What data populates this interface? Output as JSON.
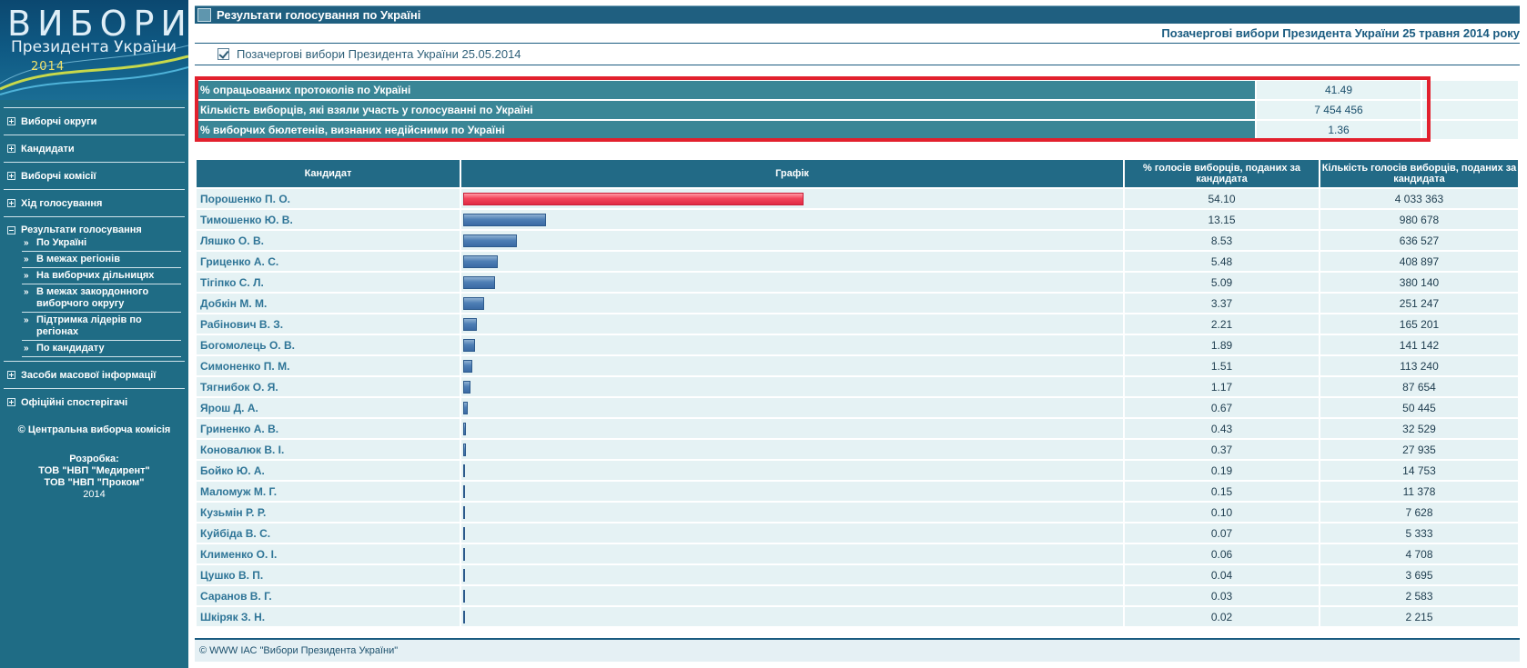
{
  "logo": {
    "big": "ВИБОРИ",
    "sub": "Президента України",
    "year": "2014"
  },
  "nav": {
    "items_top": [
      {
        "label": "Виборчі округи"
      },
      {
        "label": "Кандидати"
      },
      {
        "label": "Виборчі комісії"
      },
      {
        "label": "Хід голосування"
      }
    ],
    "open_item": "Результати голосування",
    "sub_items": [
      {
        "label": "По Україні"
      },
      {
        "label": "В межах регіонів"
      },
      {
        "label": "На виборчих дільницях"
      },
      {
        "label": "В межах закордонного виборчого округу"
      },
      {
        "label": "Підтримка лідерів по регіонах"
      },
      {
        "label": "По кандидату"
      }
    ],
    "items_bottom": [
      {
        "label": "Засоби масової інформації"
      },
      {
        "label": "Офіційні спостерігачі"
      }
    ],
    "copyright": "© Центральна виборча комісія",
    "dev_label": "Розробка:",
    "dev_line1": "ТОВ \"НВП \"Медирент\"",
    "dev_line2": "ТОВ \"НВП \"Проком\"",
    "dev_year": "2014"
  },
  "header": {
    "title": "Результати голосування по Україні",
    "election_title": "Позачергові вибори Президента України 25 травня 2014 року",
    "election_checkbox_label": "Позачергові вибори Президента України 25.05.2014"
  },
  "summary": [
    {
      "label": "% опрацьованих протоколів по Україні",
      "value": "41.49"
    },
    {
      "label": "Кількість виборців, які взяли участь у голосуванні по Україні",
      "value": "7 454 456"
    },
    {
      "label": "% виборчих бюлетенів, визнаних недійсними по Україні",
      "value": "1.36"
    }
  ],
  "results": {
    "headers": {
      "candidate": "Кандидат",
      "graph": "Графік",
      "pct": "% голосів виборців, поданих за кандидата",
      "count": "Кількість голосів виборців, поданих за кандидата"
    },
    "rows": [
      {
        "name": "Порошенко П. О.",
        "pct": "54.10",
        "count": "4 033 363"
      },
      {
        "name": "Тимошенко Ю. В.",
        "pct": "13.15",
        "count": "980 678"
      },
      {
        "name": "Ляшко О. В.",
        "pct": "8.53",
        "count": "636 527"
      },
      {
        "name": "Гриценко А. С.",
        "pct": "5.48",
        "count": "408 897"
      },
      {
        "name": "Тігіпко С. Л.",
        "pct": "5.09",
        "count": "380 140"
      },
      {
        "name": "Добкін М. М.",
        "pct": "3.37",
        "count": "251 247"
      },
      {
        "name": "Рабінович В. З.",
        "pct": "2.21",
        "count": "165 201"
      },
      {
        "name": "Богомолець О. В.",
        "pct": "1.89",
        "count": "141 142"
      },
      {
        "name": "Симоненко П. М.",
        "pct": "1.51",
        "count": "113 240"
      },
      {
        "name": "Тягнибок О. Я.",
        "pct": "1.17",
        "count": "87 654"
      },
      {
        "name": "Ярош Д. А.",
        "pct": "0.67",
        "count": "50 445"
      },
      {
        "name": "Гриненко А. В.",
        "pct": "0.43",
        "count": "32 529"
      },
      {
        "name": "Коновалюк В. І.",
        "pct": "0.37",
        "count": "27 935"
      },
      {
        "name": "Бойко Ю. А.",
        "pct": "0.19",
        "count": "14 753"
      },
      {
        "name": "Маломуж М. Г.",
        "pct": "0.15",
        "count": "11 378"
      },
      {
        "name": "Кузьмін Р. Р.",
        "pct": "0.10",
        "count": "7 628"
      },
      {
        "name": "Куйбіда В. С.",
        "pct": "0.07",
        "count": "5 333"
      },
      {
        "name": "Клименко О. І.",
        "pct": "0.06",
        "count": "4 708"
      },
      {
        "name": "Цушко В. П.",
        "pct": "0.04",
        "count": "3 695"
      },
      {
        "name": "Саранов В. Г.",
        "pct": "0.03",
        "count": "2 583"
      },
      {
        "name": "Шкіряк З. Н.",
        "pct": "0.02",
        "count": "2 215"
      }
    ]
  },
  "footer": {
    "text": "© WWW ІАС \"Вибори Президента України\""
  },
  "colors": {
    "sidebar": "#1f6c85",
    "header_bar": "#1f5f80",
    "summary_label_bg": "#3a8696",
    "row_bg": "#e5f2f4",
    "highlight_box": "#e2202d",
    "lead_bar": "#e02a43",
    "bar": "#4e7fb5"
  }
}
